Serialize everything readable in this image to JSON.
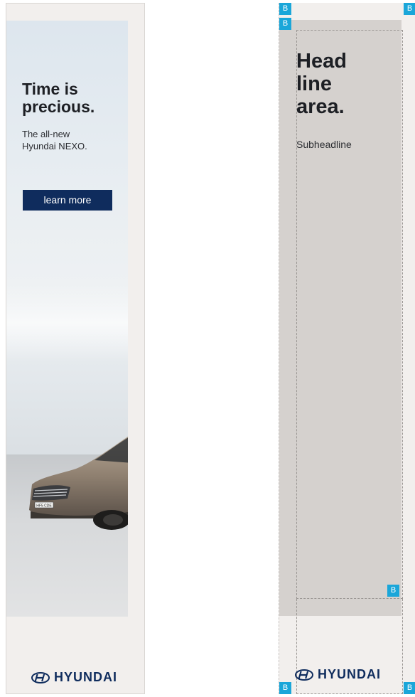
{
  "banner": {
    "headline": [
      "Time is",
      "precious."
    ],
    "subline": [
      "The all-new",
      "Hyundai NEXO."
    ],
    "cta_label": "learn more",
    "plate_text": "HF5 CDE",
    "logo_text": "HYUNDAI"
  },
  "template": {
    "headline": [
      "Head",
      "line",
      "area."
    ],
    "subheadline": "Subheadline",
    "badge_label": "B",
    "logo_text": "HYUNDAI"
  },
  "colors": {
    "brand_navy": "#0f2c5d",
    "badge_blue": "#1aa6d9",
    "placeholder_gray": "#d5d1ce",
    "background": "#f2efed"
  },
  "icons": [
    "hyundai-logo-icon"
  ]
}
